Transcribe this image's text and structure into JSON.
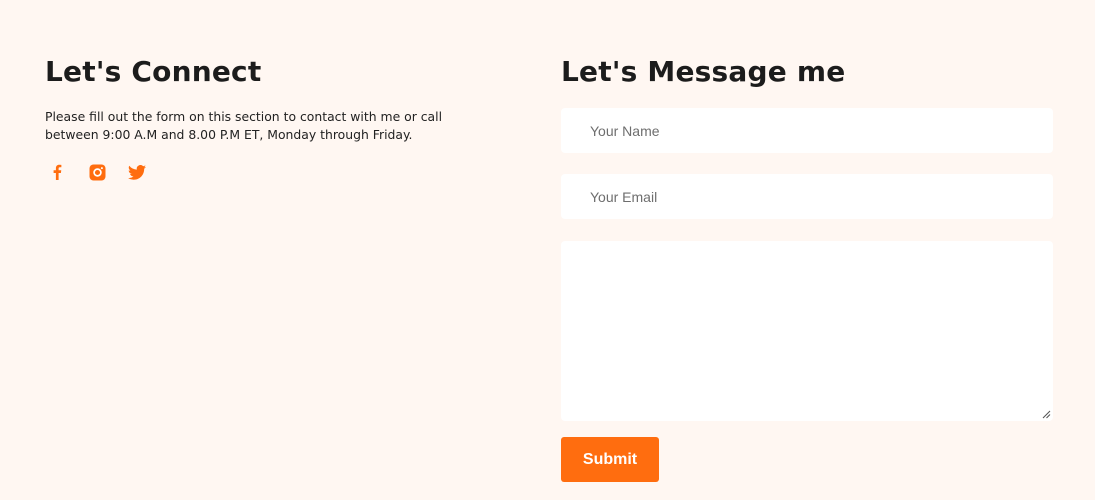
{
  "connect": {
    "title": "Let's Connect",
    "description": "Please fill out the form on this section to contact with me or call between 9:00 A.M and 8.00 P.M ET, Monday through Friday.",
    "socials": [
      {
        "icon": "facebook-icon"
      },
      {
        "icon": "instagram-icon"
      },
      {
        "icon": "twitter-icon"
      }
    ]
  },
  "form": {
    "title": "Let's Message me",
    "name_placeholder": "Your Name",
    "email_placeholder": "Your Email",
    "message_placeholder": "",
    "submit_label": "Submit"
  },
  "colors": {
    "background": "#fff7f2",
    "accent": "#ff6d0f",
    "field_background": "#ffffff"
  }
}
